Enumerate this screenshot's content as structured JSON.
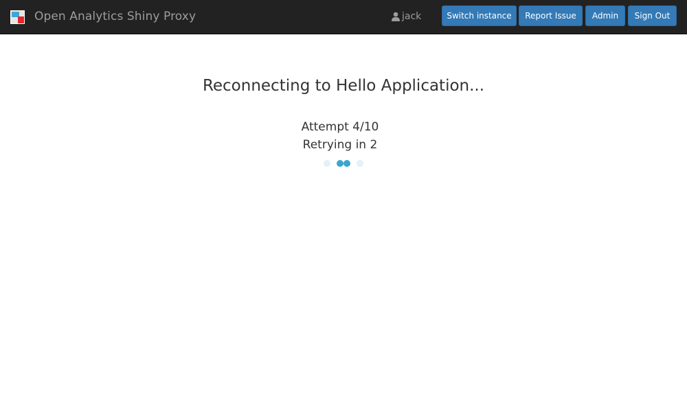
{
  "navbar": {
    "brand": "Open Analytics Shiny Proxy",
    "logo_icon": "openanalytics-logo-icon",
    "user": {
      "icon": "user-icon",
      "name": "jack"
    },
    "buttons": {
      "switch_instance": "Switch instance",
      "report_issue": "Report Issue",
      "admin": "Admin",
      "sign_out": "Sign Out"
    }
  },
  "main": {
    "title": "Reconnecting to Hello Application...",
    "attempt": "Attempt 4/10",
    "retrying": "Retrying in 2",
    "loader_icon": "loading-dots-icon"
  },
  "colors": {
    "navbar_bg": "#222222",
    "button_primary": "#337ab7",
    "loader_active": "#3aa6d0",
    "loader_inactive": "#e3f1f8"
  }
}
